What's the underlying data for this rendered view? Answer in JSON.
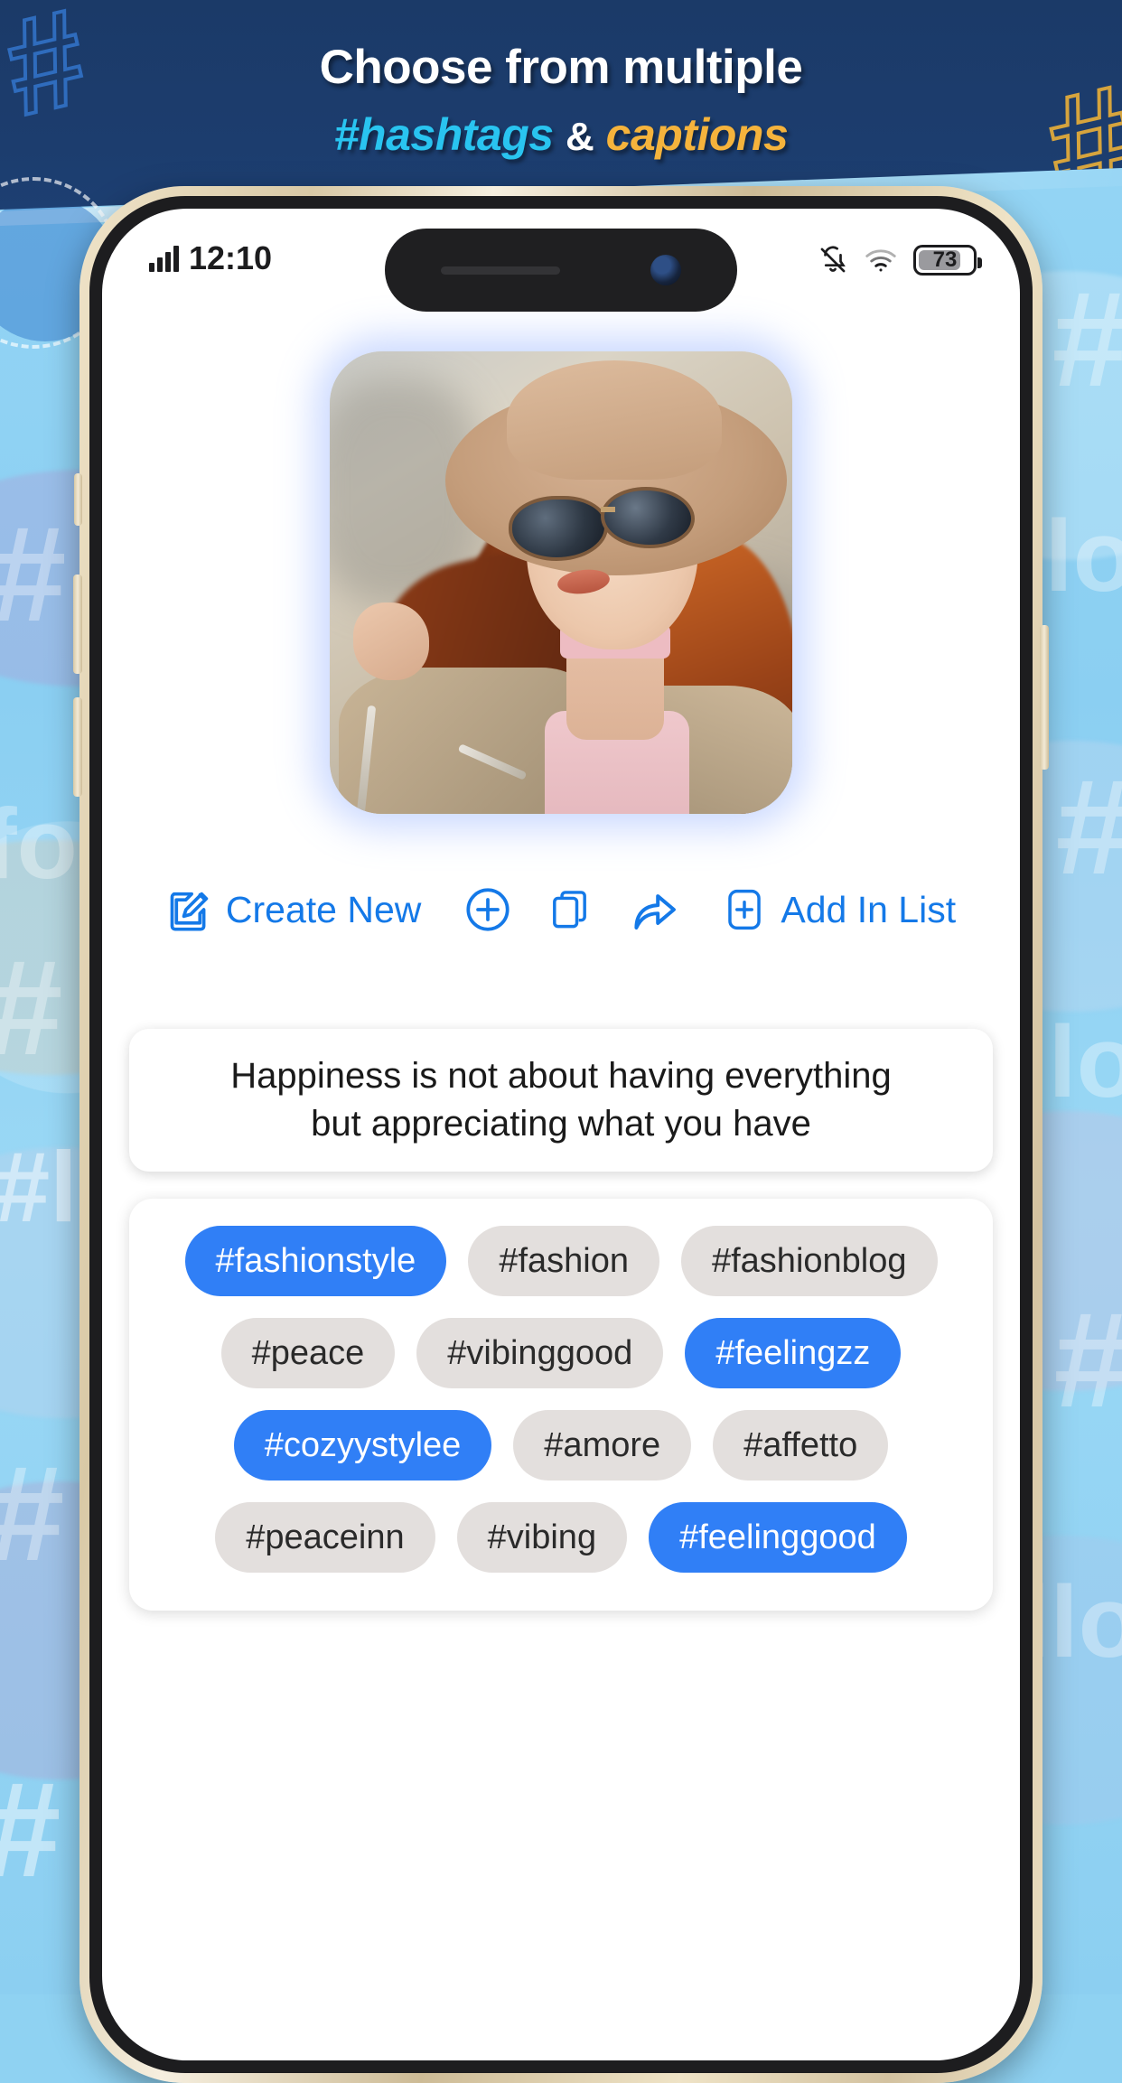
{
  "promo": {
    "title": "Choose from multiple",
    "subtitle_hashtags": "#hashtags",
    "subtitle_amp": "&",
    "subtitle_captions": "captions",
    "deco_hash_left": "#",
    "deco_hash_right": "#",
    "colors": {
      "band": "#1b3a68",
      "title": "#ffffff",
      "hashtags": "#29c4f0",
      "captions": "#f5b33c",
      "background": "#8fd2f2"
    }
  },
  "background_watermarks": [
    "#",
    "fo",
    "#",
    "lo",
    "#",
    "#",
    "#",
    "fo",
    "#",
    "lo",
    "#"
  ],
  "status_bar": {
    "time": "12:10",
    "signal_icon": "signal-bars-icon",
    "mute_icon": "bell-slash-icon",
    "wifi_icon": "wifi-icon",
    "battery_level": "73",
    "battery_icon": "battery-icon"
  },
  "photo": {
    "alt_name": "woman-with-hat-and-sunglasses"
  },
  "toolbar": {
    "create_new_label": "Create New",
    "create_new_icon": "edit-pencil-icon",
    "add_icon": "plus-circle-icon",
    "copy_icon": "copy-icon",
    "share_icon": "share-arrow-icon",
    "add_in_list_label": "Add In List",
    "add_in_list_icon": "plus-square-icon",
    "accent_color": "#1479e8"
  },
  "caption": {
    "text": "Happiness is not about having everything\nbut appreciating what you have"
  },
  "hashtags": {
    "selected_color": "#307ff6",
    "unselected_color": "#e3dfdd",
    "rows": [
      [
        {
          "label": "#fashionstyle",
          "selected": true
        },
        {
          "label": "#fashion",
          "selected": false
        },
        {
          "label": "#fashionblog",
          "selected": false
        }
      ],
      [
        {
          "label": "#peace",
          "selected": false
        },
        {
          "label": "#vibinggood",
          "selected": false
        },
        {
          "label": "#feelingzz",
          "selected": true
        }
      ],
      [
        {
          "label": "#cozyystylee",
          "selected": true
        },
        {
          "label": "#amore",
          "selected": false
        },
        {
          "label": "#affetto",
          "selected": false
        }
      ],
      [
        {
          "label": "#peaceinn",
          "selected": false
        },
        {
          "label": "#vibing",
          "selected": false
        },
        {
          "label": "#feelinggood",
          "selected": true
        }
      ]
    ]
  }
}
